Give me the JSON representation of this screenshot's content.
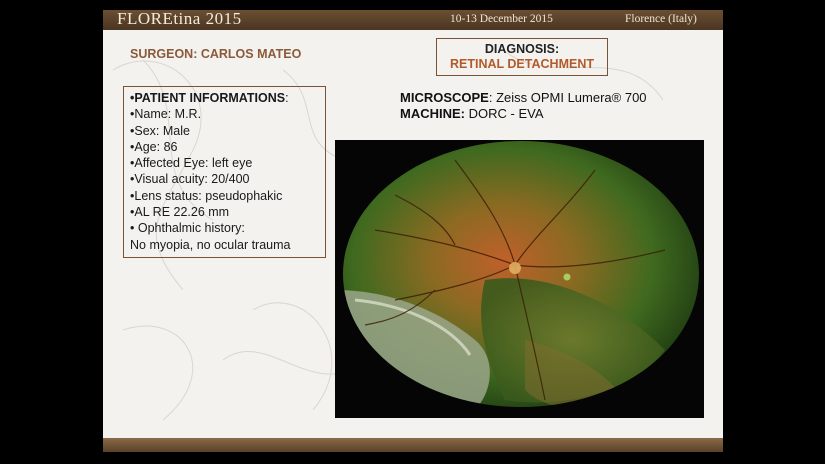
{
  "header": {
    "title": "FLOREtina 2015",
    "dates": "10-13 December 2015",
    "place": "Florence (Italy)"
  },
  "surgeon": "SURGEON: CARLOS MATEO",
  "diagnosis": {
    "label": "DIAGNOSIS:",
    "value": "RETINAL DETACHMENT"
  },
  "patient": {
    "heading": "•PATIENT INFORMATIONS",
    "heading_suffix": ":",
    "lines": [
      "•Name: M.R.",
      "•Sex: Male",
      "•Age: 86",
      "•Affected Eye: left eye",
      "•Visual acuity: 20/400",
      "•Lens status: pseudophakic",
      "•AL RE 22.26 mm",
      "• Ophthalmic history:",
      "No myopia, no ocular trauma"
    ]
  },
  "equipment": {
    "microscope_label": "MICROSCOPE",
    "microscope_value": ": Zeiss OPMI Lumera® 700",
    "machine_label": "MACHINE:",
    "machine_value": " DORC - EVA"
  },
  "colors": {
    "header_bg": "#5a4128",
    "accent_brown": "#7a5236",
    "diagnosis_text": "#b35a2a",
    "surgeon_text": "#8a5a3a"
  }
}
